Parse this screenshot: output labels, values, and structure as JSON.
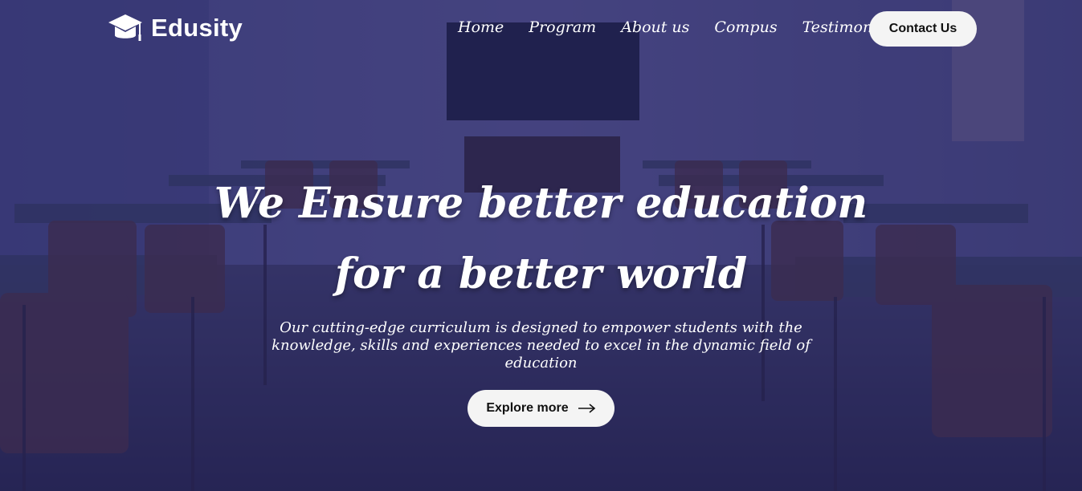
{
  "brand": {
    "name": "Edusity",
    "icon": "graduation-cap-icon"
  },
  "nav": {
    "items": [
      {
        "label": "Home"
      },
      {
        "label": "Program"
      },
      {
        "label": "About us"
      },
      {
        "label": "Compus"
      },
      {
        "label": "Testimonials"
      }
    ],
    "contact_label": "Contact Us"
  },
  "hero": {
    "title": "We Ensure better education for a better world",
    "subtitle": "Our cutting-edge curriculum is designed to empower students with the knowledge, skills and experiences needed to excel in the dynamic field of education",
    "cta_label": "Explore more",
    "cta_icon": "arrow-right-icon"
  },
  "colors": {
    "overlay": "#23205a",
    "button_bg": "#f4f4f4",
    "button_text": "#111111"
  }
}
